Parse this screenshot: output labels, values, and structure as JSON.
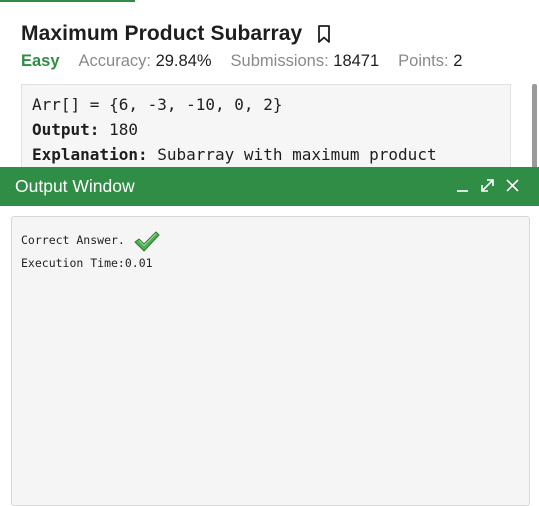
{
  "problem": {
    "title": "Maximum Product Subarray",
    "difficulty": "Easy",
    "accuracy_label": "Accuracy:",
    "accuracy_value": "29.84%",
    "submissions_label": "Submissions:",
    "submissions_value": "18471",
    "points_label": "Points:",
    "points_value": "2"
  },
  "example": {
    "input_line": "Arr[] = {6, -3, -10, 0, 2}",
    "output_label": "Output:",
    "output_value": " 180",
    "explanation_label": "Explanation:",
    "explanation_value": " Subarray with maximum product"
  },
  "output_window": {
    "title": "Output Window",
    "result": "Correct Answer.",
    "execution": "Execution Time:0.01"
  },
  "colors": {
    "accent": "#2f8d46",
    "check": "#4caf50"
  },
  "icons": {
    "bookmark": "bookmark-icon",
    "minimize": "minimize-icon",
    "expand": "expand-icon",
    "close": "close-icon",
    "check": "check-icon"
  }
}
